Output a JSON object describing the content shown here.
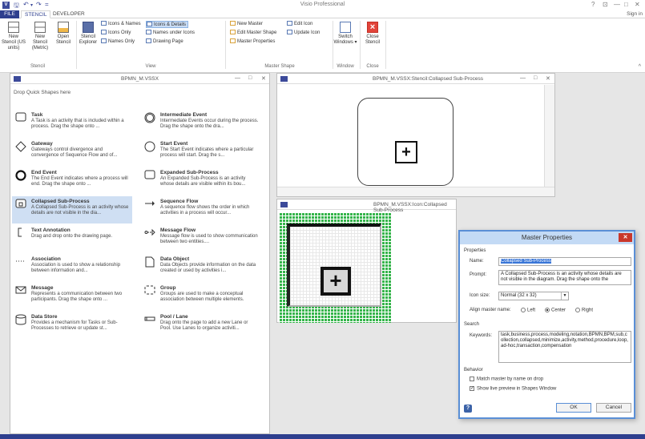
{
  "titlebar": {
    "title": "Visio Professional",
    "app_icon": "V",
    "qat": {
      "save": "🖫",
      "undo": "↶",
      "undo_arrow": "▾",
      "redo": "↷",
      "more": "="
    },
    "controls": {
      "help": "?",
      "restore": "⊡",
      "minimize": "—",
      "maximize": "□",
      "close": "✕"
    }
  },
  "tabs": {
    "file": "FILE",
    "stencil": "STENCIL",
    "developer": "DEVELOPER",
    "signin": "Sign in"
  },
  "ribbon": {
    "new_stencil_us": "New Stencil (US units)",
    "new_stencil_metric": "New Stencil (Metric)",
    "open_stencil": "Open Stencil",
    "stencil_explorer": "Stencil Explorer",
    "icons_names": "Icons & Names",
    "icons_only": "Icons Only",
    "names_only": "Names Only",
    "icons_details": "Icons & Details",
    "names_under_icons": "Names under Icons",
    "drawing_page": "Drawing Page",
    "new_master": "New Master",
    "edit_master_shape": "Edit Master Shape",
    "master_properties": "Master Properties",
    "edit_icon": "Edit Icon",
    "update_icon": "Update Icon",
    "switch_windows": "Switch Windows ▾",
    "close_stencil": "Close Stencil",
    "groups": {
      "stencil": "Stencil",
      "view": "View",
      "master_shape": "Master Shape",
      "window": "Window",
      "close": "Close"
    },
    "collapse": "^"
  },
  "stencil_window": {
    "title": "BPMN_M.VSSX",
    "hint": "Drop Quick Shapes here",
    "controls": {
      "minimize": "—",
      "maximize": "□",
      "close": "✕"
    },
    "shapes": [
      {
        "name": "Task",
        "desc": "A Task is an activity that is included within a process. Drag the shape onto ...",
        "icon": "task-icon"
      },
      {
        "name": "Intermediate Event",
        "desc": "Intermediate Events occur during the process. Drag the shape onto the dra...",
        "icon": "intermediate-event-icon"
      },
      {
        "name": "Gateway",
        "desc": "Gateways control divergence and convergence of Sequence Flow and of...",
        "icon": "gateway-icon"
      },
      {
        "name": "Start Event",
        "desc": "The Start Event indicates where a particular process will start. Drag the s...",
        "icon": "start-event-icon"
      },
      {
        "name": "End Event",
        "desc": "The End Event indicates where a process will end. Drag the shape onto ...",
        "icon": "end-event-icon"
      },
      {
        "name": "Expanded Sub-Process",
        "desc": "An Expanded Sub-Process is an activity whose details are visible within its bou...",
        "icon": "expanded-subprocess-icon"
      },
      {
        "name": "Collapsed Sub-Process",
        "desc": "A Collapsed Sub-Process is an activity whose details are not visible in the dia...",
        "icon": "collapsed-subprocess-icon"
      },
      {
        "name": "Sequence Flow",
        "desc": "A sequence flow shows the order in which activities in a process will occur...",
        "icon": "sequence-flow-icon"
      },
      {
        "name": "Text Annotation",
        "desc": "Drag and drop onto the drawing page.",
        "icon": "text-annotation-icon"
      },
      {
        "name": "Message Flow",
        "desc": "Message flow is used to show communication between two entities....",
        "icon": "message-flow-icon"
      },
      {
        "name": "Association",
        "desc": "Association is used to show a relationship between information and...",
        "icon": "association-icon"
      },
      {
        "name": "Data Object",
        "desc": "Data Objects provide information on the data created or used by activities i...",
        "icon": "data-object-icon"
      },
      {
        "name": "Message",
        "desc": "Represents a communication between two participants. Drag the shape onto ...",
        "icon": "message-icon"
      },
      {
        "name": "Group",
        "desc": "Groups are used to make a conceptual association between multiple elements.",
        "icon": "group-icon"
      },
      {
        "name": "Data Store",
        "desc": "Provides a mechanism for Tasks or Sub-Processes to retrieve or update st...",
        "icon": "data-store-icon"
      },
      {
        "name": "Pool / Lane",
        "desc": "Drag onto the page to add a new Lane or Pool. Use Lanes to organize activiti...",
        "icon": "pool-lane-icon"
      }
    ]
  },
  "doc_window": {
    "title": "BPMN_M.VSSX:Stencil:Collapsed Sub-Process",
    "controls": {
      "minimize": "—",
      "maximize": "□",
      "close": "✕"
    },
    "plus": "+"
  },
  "icon_window": {
    "title": "BPMN_M.VSSX:Icon:Collapsed Sub-Process",
    "plus": "+"
  },
  "dialog": {
    "title": "Master Properties",
    "close": "✕",
    "properties_label": "Properties",
    "name_label": "Name:",
    "name_value": "Collapsed Sub-Process",
    "prompt_label": "Prompt:",
    "prompt_value": "A Collapsed Sub-Process is an activity whose details are not visible in the diagram. Drag the shape onto the",
    "icon_size_label": "Icon size:",
    "icon_size_value": "Normal (32 x 32)",
    "align_label": "Align master name:",
    "align_options": [
      "Left",
      "Center",
      "Right"
    ],
    "align_selected": "Center",
    "search_label": "Search",
    "keywords_label": "Keywords:",
    "keywords_value": "task,business,process,modeling,notation,BPMN,BPM,sub,collection,collapsed,minimize,activity,method,procedure,loop,ad-hoc,transaction,compensation",
    "behavior_label": "Behavior",
    "match_master": "Match master by name on drop",
    "match_master_checked": false,
    "show_preview": "Show live preview in Shapes Window",
    "show_preview_checked": true,
    "help": "?",
    "ok": "OK",
    "cancel": "Cancel"
  }
}
